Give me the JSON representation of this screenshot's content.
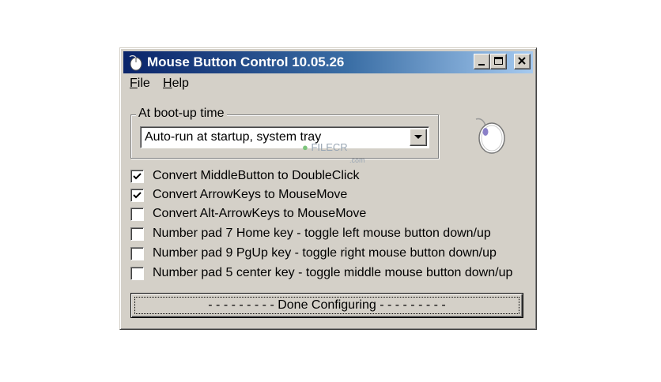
{
  "window": {
    "title": "Mouse Button Control 10.05.26"
  },
  "menu": {
    "file": {
      "underline": "F",
      "rest": "ile"
    },
    "help": {
      "underline": "H",
      "rest": "elp"
    }
  },
  "boot": {
    "legend": "At boot-up time",
    "selected": "Auto-run at startup, system tray"
  },
  "watermark": {
    "brand": "FILECR",
    "sub": ".com"
  },
  "options": [
    {
      "label": "Convert MiddleButton to DoubleClick",
      "checked": true
    },
    {
      "label": "Convert ArrowKeys to MouseMove",
      "checked": true
    },
    {
      "label": "Convert Alt-ArrowKeys to MouseMove",
      "checked": false
    },
    {
      "label": "Number pad 7 Home key - toggle left mouse button down/up",
      "checked": false
    },
    {
      "label": "Number pad 9 PgUp key - toggle right mouse button down/up",
      "checked": false
    },
    {
      "label": "Number pad 5 center key - toggle middle mouse button down/up",
      "checked": false
    }
  ],
  "done_button": {
    "label": "- - - - - - - - -  Done Configuring  - - - - - - - - -"
  },
  "colors": {
    "window_face": "#d4d0c8",
    "titlebar_start": "#0a246a",
    "titlebar_end": "#a6caf0"
  },
  "icons": {
    "title": "mouse-icon",
    "decor": "mouse-icon"
  }
}
